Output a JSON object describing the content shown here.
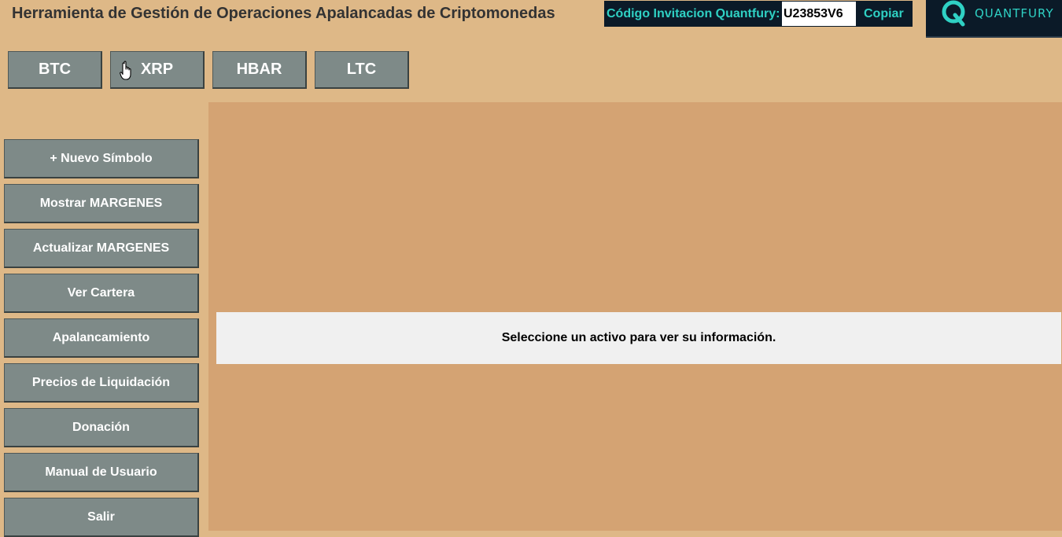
{
  "header": {
    "title": "Herramienta de Gestión de Operaciones Apalancadas de Criptomonedas",
    "invite_label": "Código Invitacion Quantfury:",
    "invite_code": "U23853V6",
    "copy_label": "Copiar",
    "brand_name": "QUANTFURY",
    "brand_icon": "quantfury-logo-icon"
  },
  "coin_tabs": [
    {
      "label": "BTC"
    },
    {
      "label": "XRP"
    },
    {
      "label": "HBAR"
    },
    {
      "label": "LTC"
    }
  ],
  "sidebar": {
    "items": [
      {
        "label": "+ Nuevo Símbolo"
      },
      {
        "label": "Mostrar MARGENES"
      },
      {
        "label": "Actualizar MARGENES"
      },
      {
        "label": "Ver Cartera"
      },
      {
        "label": "Apalancamiento"
      },
      {
        "label": "Precios de Liquidación"
      },
      {
        "label": "Donación"
      },
      {
        "label": "Manual de Usuario"
      },
      {
        "label": "Salir"
      }
    ]
  },
  "main": {
    "message": "Seleccione un activo para ver su información."
  },
  "colors": {
    "background": "#deb887",
    "panel": "#d4a373",
    "button": "#7e8a88",
    "brand_dark": "#0b1a28",
    "brand_accent": "#2fd1c4"
  }
}
